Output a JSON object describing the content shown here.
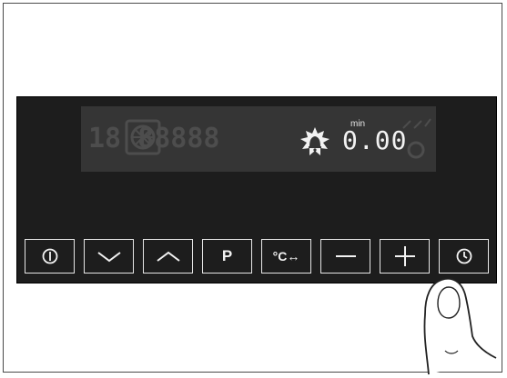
{
  "display": {
    "timer_unit": "min",
    "timer_value": "0.00",
    "ghost_segments": "18 88888"
  },
  "buttons": [
    {
      "name": "power-button",
      "icon": "power-icon",
      "label": ""
    },
    {
      "name": "down-button",
      "icon": "chevron-down-icon",
      "label": ""
    },
    {
      "name": "up-button",
      "icon": "chevron-up-icon",
      "label": ""
    },
    {
      "name": "program-button",
      "icon": "",
      "label": "P"
    },
    {
      "name": "temperature-button",
      "icon": "",
      "label": "°C↔"
    },
    {
      "name": "minus-button",
      "icon": "minus-icon",
      "label": ""
    },
    {
      "name": "plus-button",
      "icon": "plus-icon",
      "label": ""
    },
    {
      "name": "clock-button",
      "icon": "clock-icon",
      "label": ""
    }
  ],
  "colors": {
    "panel": "#1d1d1d",
    "display": "#353535",
    "lit_segment": "#f2f2f2",
    "unlit_segment": "#4d4d4d"
  }
}
